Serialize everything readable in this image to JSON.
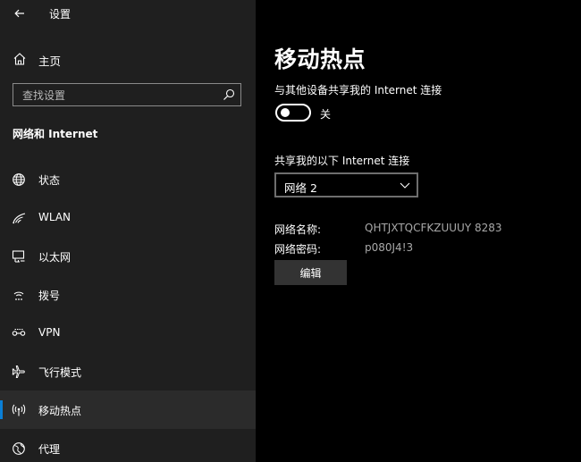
{
  "window": {
    "title": "设置"
  },
  "sidebar": {
    "home_label": "主页",
    "search_placeholder": "查找设置",
    "section_title": "网络和 Internet",
    "items": [
      {
        "label": "状态",
        "icon": "globe-icon"
      },
      {
        "label": "WLAN",
        "icon": "wifi-icon"
      },
      {
        "label": "以太网",
        "icon": "ethernet-icon"
      },
      {
        "label": "拨号",
        "icon": "dialup-icon"
      },
      {
        "label": "VPN",
        "icon": "vpn-icon"
      },
      {
        "label": "飞行模式",
        "icon": "airplane-icon"
      },
      {
        "label": "移动热点",
        "icon": "hotspot-icon",
        "active": true
      },
      {
        "label": "代理",
        "icon": "proxy-globe-icon"
      }
    ]
  },
  "main": {
    "title": "移动热点",
    "share_label": "与其他设备共享我的 Internet 连接",
    "toggle_state": "关",
    "toggle_on": false,
    "conn_label": "共享我的以下 Internet 连接",
    "conn_selected": "网络 2",
    "network_name_key": "网络名称:",
    "network_name_value": "QHTJXTQCFKZUUUY 8283",
    "network_password_key": "网络密码:",
    "network_password_value": "p080J4!3",
    "edit_button": "编辑"
  },
  "colors": {
    "sidebar_bg": "#1f1f1f",
    "main_bg": "#000000",
    "accent": "#0a7fd6",
    "active_item_bg": "#2b2b2b",
    "button_bg": "#333333",
    "secondary_text": "#a8a8a8"
  }
}
